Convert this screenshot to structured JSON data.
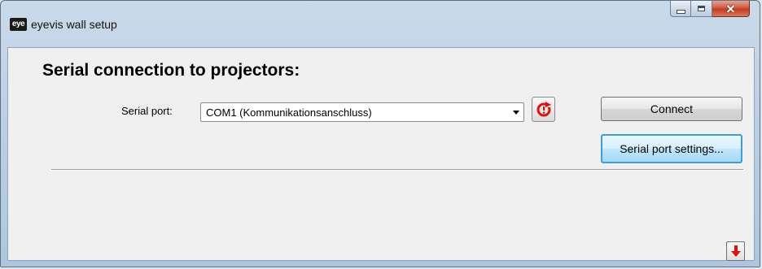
{
  "window": {
    "title": "eyevis wall setup",
    "icon_text": "eye"
  },
  "main": {
    "heading": "Serial connection to projectors:",
    "serial_port_label": "Serial port:",
    "serial_port_value": "COM1 (Kommunikationsanschluss)",
    "connect_label": "Connect",
    "settings_label": "Serial port settings..."
  },
  "icons": {
    "app": "eyevis-logo-icon",
    "refresh": "refresh-icon",
    "expand": "arrow-down-icon",
    "accent_red": "#e01010"
  }
}
